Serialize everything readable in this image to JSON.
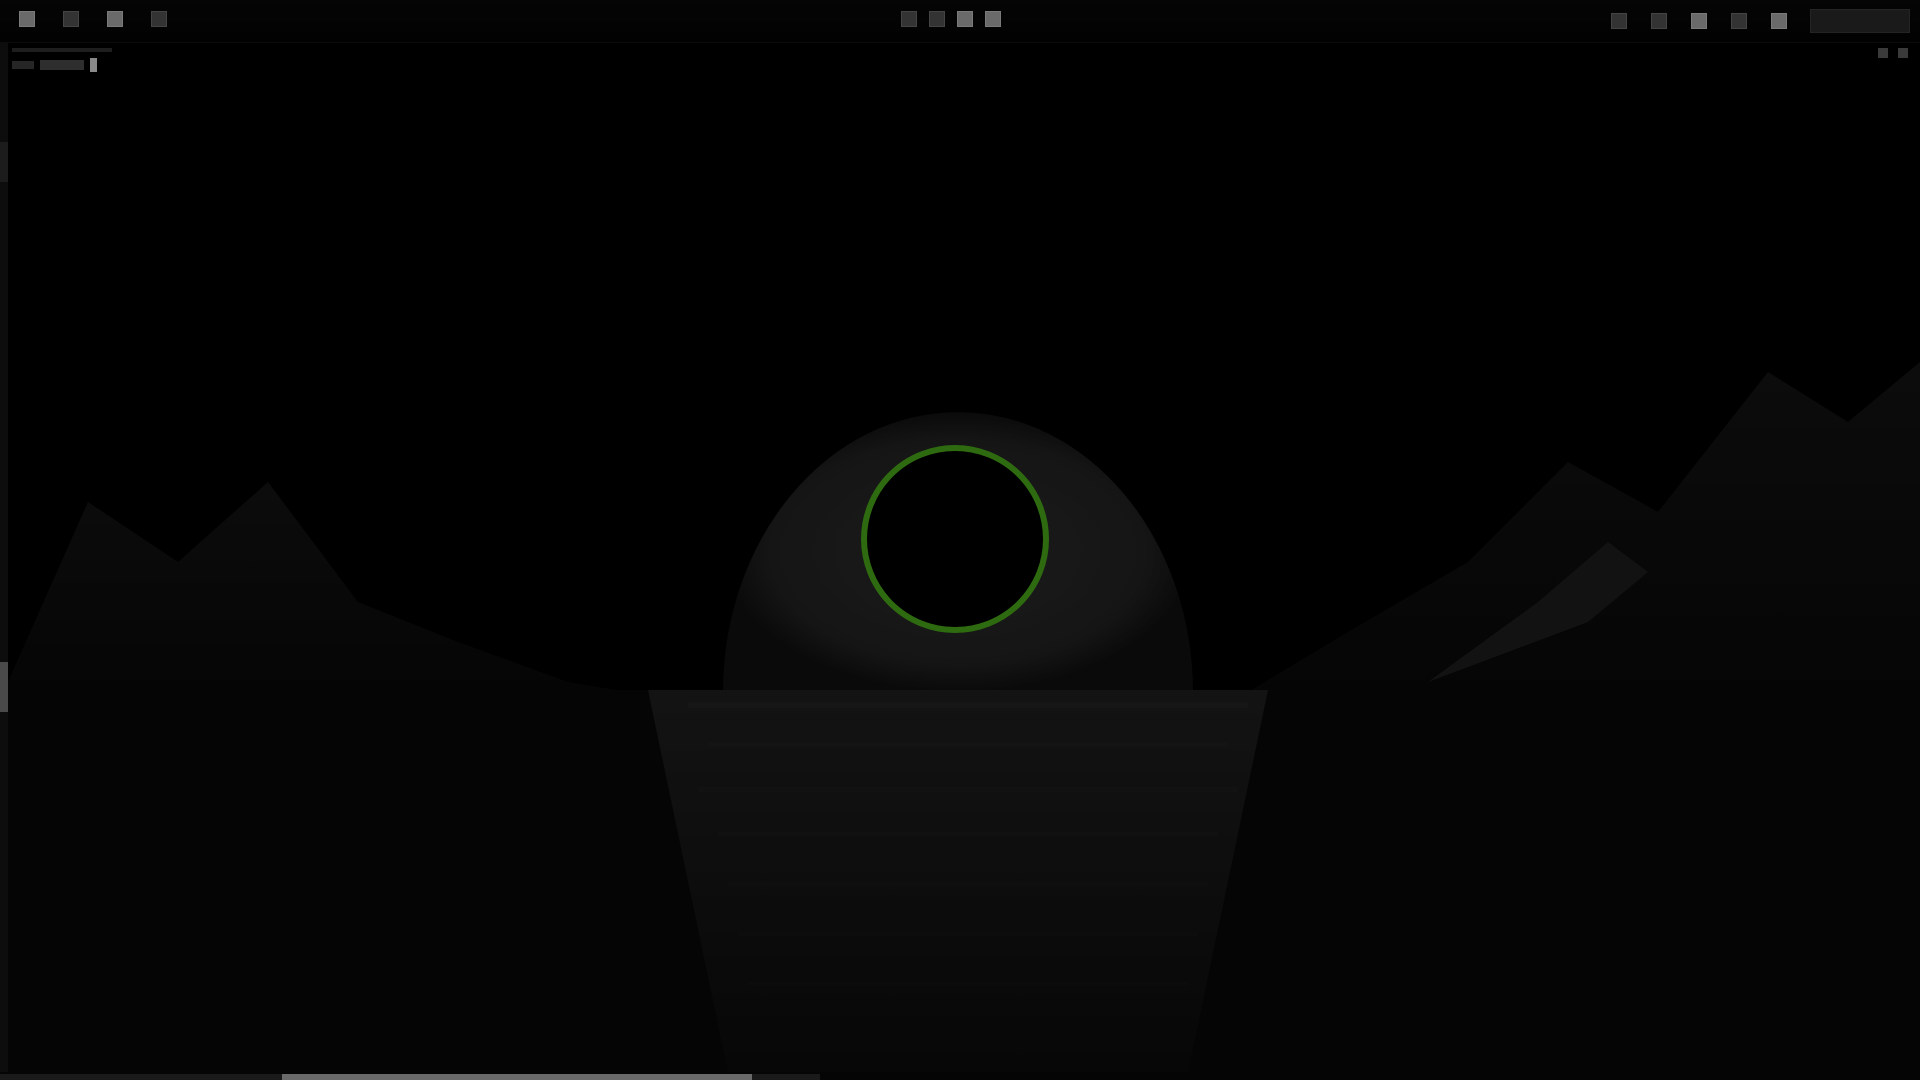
{
  "toolbar_left": {
    "icons": [
      "layout-icon",
      "menu-icon",
      "grid-icon",
      "camera-icon"
    ]
  },
  "toolbar_center": {
    "icons": [
      "view-icon",
      "move-icon",
      "rotate-icon",
      "scale-icon"
    ]
  },
  "toolbar_right": {
    "icons": [
      "light-icon",
      "sphere-icon",
      "settings-icon",
      "shading-icon",
      "overlay-icon"
    ]
  },
  "colors": {
    "target_ring": "#2e6b10",
    "horizon_glow": "#1a1a1a",
    "background": "#000000"
  }
}
